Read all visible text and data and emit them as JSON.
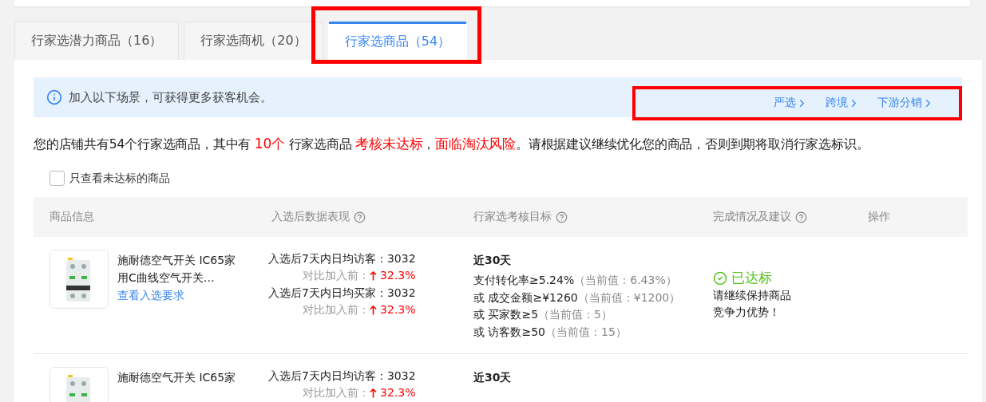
{
  "tabs": [
    {
      "label": "行家选潜力商品（16）",
      "selected": false,
      "highlighted": false
    },
    {
      "label": "行家选商机（20）",
      "selected": false,
      "highlighted": false
    },
    {
      "label": "行家选商品（54）",
      "selected": true,
      "highlighted": true
    }
  ],
  "banner": {
    "text": "加入以下场景，可获得更多获客机会。",
    "links": [
      "严选",
      "跨境",
      "下游分销"
    ],
    "links_highlighted": true
  },
  "summary": [
    {
      "text": "您的店铺共有54个行家选商品，其中有 ",
      "highlight": "10个"
    },
    {
      "text": " 行家选商品 ",
      "highlight": "考核未达标"
    },
    {
      "text": "，",
      "highlight": "面临淘汰风险"
    },
    {
      "text": "。请根据建议继续优化您的商品，否则到期将取消行家选标识。"
    }
  ],
  "filter": {
    "label": "只查看未达标的商品",
    "checked": false
  },
  "columns": [
    {
      "label": "商品信息",
      "help": false
    },
    {
      "label": "入选后数据表现",
      "help": true
    },
    {
      "label": "行家选考核目标",
      "help": true
    },
    {
      "label": "完成情况及建议",
      "help": true
    },
    {
      "label": "操作",
      "help": false
    }
  ],
  "rows": [
    {
      "product": {
        "kind": "picture",
        "name": "施耐德空气开关 IC65家用C曲线空气开关…",
        "link": "查看入选要求"
      },
      "metrics": [
        {
          "label": "入选后7天内日均访客：",
          "value": "3032",
          "compare_label": "对比加入前：",
          "change": "32.3%"
        },
        {
          "label": "入选后7天内日均买家：",
          "value": "3032",
          "compare_label": "对比加入前：",
          "change": "32.3%"
        }
      ],
      "goals": {
        "period": "近30天",
        "conditions": [
          {
            "text": "支付转化率≥5.24%",
            "current": "（当前值：6.43%）"
          },
          {
            "text": "或 成交金额≥¥1260",
            "current": "（当前值：¥1200）"
          },
          {
            "text": "或 买家数≥5",
            "current": "（当前值：5）"
          },
          {
            "text": "或 访客数≥50",
            "current": "（当前值：15）"
          }
        ]
      },
      "status": {
        "label": "已达标",
        "met": true,
        "advice": "请继续保持商品竞争力优势！"
      }
    },
    {
      "product": {
        "kind": "picture",
        "name": "施耐德空气开关 IC65家"
      },
      "metrics": [
        {
          "label": "入选后7天内日均访客：",
          "value": "3032",
          "compare_label": "对比加入前：",
          "change": "32.3%"
        }
      ],
      "goals": {
        "period": "近30天"
      }
    }
  ]
}
